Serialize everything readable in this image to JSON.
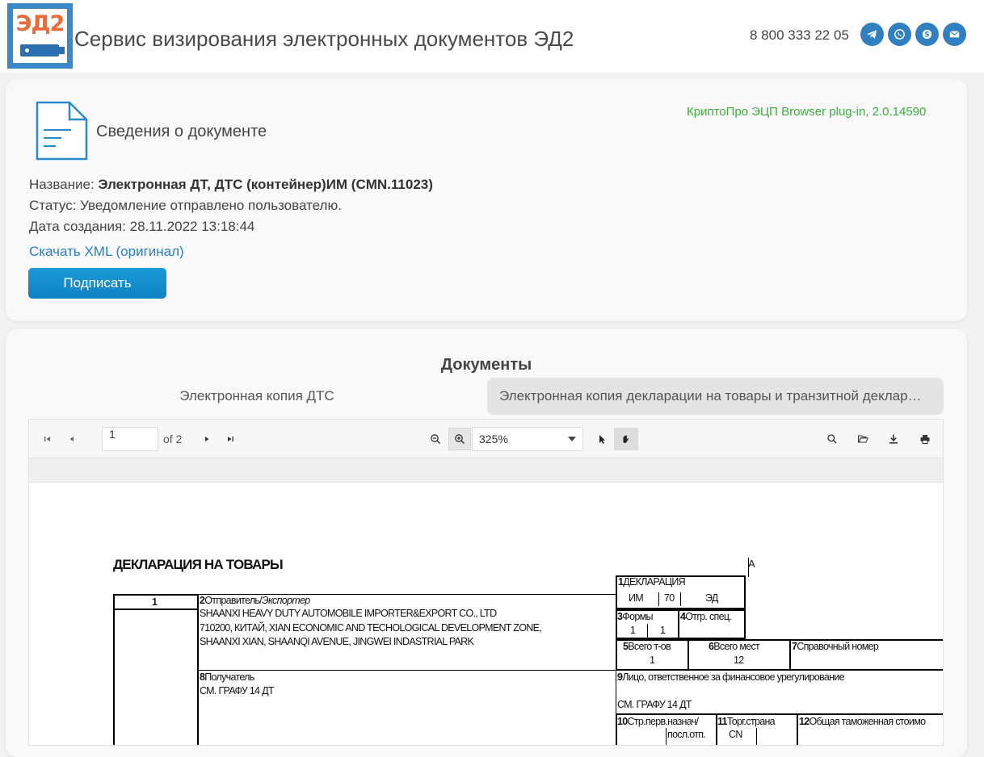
{
  "header": {
    "logo_text": "ЭД2",
    "title": "Сервис визирования электронных документов ЭД2",
    "phone": "8 800 333 22 05",
    "social": [
      "telegram-icon",
      "whatsapp-icon",
      "skype-icon",
      "email-icon"
    ],
    "accent_color": "#2f7fc1"
  },
  "document_info": {
    "heading": "Сведения о документе",
    "plugin_status": "КриптоПро ЭЦП Browser plug-in, 2.0.14590",
    "name_label": "Название: ",
    "name_value": "Электронная ДТ, ДТС (контейнер)ИМ (CMN.11023)",
    "status": "Статус: Уведомление отправлено пользователю.",
    "created": "Дата создания: 28.11.2022 13:18:44",
    "download_link": "Скачать XML (оригинал)",
    "sign_button": "Подписать"
  },
  "documents": {
    "title": "Документы",
    "tabs": [
      {
        "label": "Электронная копия ДТС",
        "active": false
      },
      {
        "label": "Электронная копия декларации на товары и транзитной декларации",
        "active": true
      }
    ]
  },
  "viewer": {
    "page_current": "1",
    "page_total": "of 2",
    "zoom": "325%"
  },
  "pdf_page": {
    "title": "ДЕКЛАРАЦИЯ НА ТОВАРЫ",
    "corner_letter": "A",
    "box1_num": "1",
    "f1_label_num": "1",
    "f1_label": "ДЕКЛАРАЦИЯ",
    "f1_v1": "ИМ",
    "f1_v2": "70",
    "f1_v3": "ЭД",
    "f2_num": "2",
    "f2_label": "Отправитель/",
    "f2_label_it": "Экспортер",
    "f2_line1": "SHAANXI HEAVY DUTY AUTOMOBILE IMPORTER&EXPORT CO., LTD",
    "f2_line2": "710200, КИТАЙ, XIAN ECONOMIC AND TECHOLOGICAL DEVELOPMENT ZONE,",
    "f2_line3": "SHAANXI XIAN, SHAANQI AVENUE, JINGWEI INDASTRIAL PARK",
    "f3_num": "3",
    "f3_label": "Формы",
    "f3_v1": "1",
    "f3_v2": "1",
    "f4_num": "4",
    "f4_label": "Отгр. спец.",
    "f5_num": "5",
    "f5_label": "Всего т-ов",
    "f5_v": "1",
    "f6_num": "6",
    "f6_label": "Всего мест",
    "f6_v": "12",
    "f7_num": "7",
    "f7_label": "Справочный номер",
    "f8_num": "8",
    "f8_label": "Получатель",
    "f8_v": "СМ. ГРАФУ 14 ДТ",
    "f9_num": "9",
    "f9_label": "Лицо, ответственное за финансовое урегулирование",
    "f9_v": "СМ. ГРАФУ 14 ДТ",
    "f10_num": "10",
    "f10_label": "Стр.перв.назнач/",
    "f10_label2": "посл.отп.",
    "f11_num": "11",
    "f11_label": "Торг.страна",
    "f11_v": "CN",
    "f12_num": "12",
    "f12_label": "Общая таможенная стоимо"
  }
}
